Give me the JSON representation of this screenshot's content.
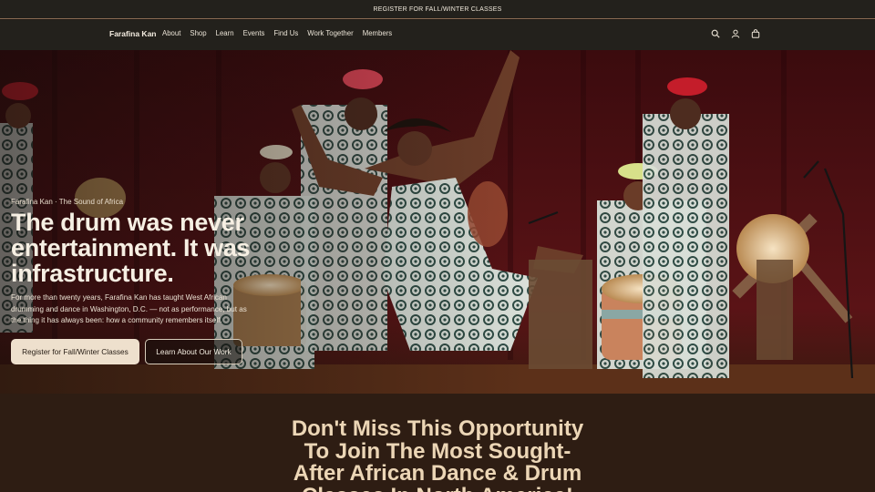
{
  "announcement": {
    "text": "REGISTER FOR FALL/WINTER CLASSES"
  },
  "header": {
    "brand": "Farafina Kan",
    "nav": [
      "About",
      "Shop",
      "Learn",
      "Events",
      "Find Us",
      "Work Together",
      "Members"
    ],
    "icons": [
      "search-icon",
      "account-icon",
      "cart-icon"
    ]
  },
  "hero": {
    "eyebrow": "Farafina Kan · The Sound of Africa",
    "headline": "The drum was never entertainment. It was infrastructure.",
    "lede": "For more than twenty years, Farafina Kan has taught West African drumming and dance in Washington, D.C. — not as performance, but as the thing it has always been: how a community remembers itself.",
    "primary_cta": "Register for Fall/Winter Classes",
    "secondary_cta": "Learn About Our Work",
    "image_description_colors": {
      "curtain": "#4a0f12",
      "fabric": "#3f5f55",
      "floor": "#6b3a1f"
    }
  },
  "promo": {
    "title": "Don't Miss This Opportunity To Join The Most Sought-After African Dance & Drum Classes In North America!"
  }
}
